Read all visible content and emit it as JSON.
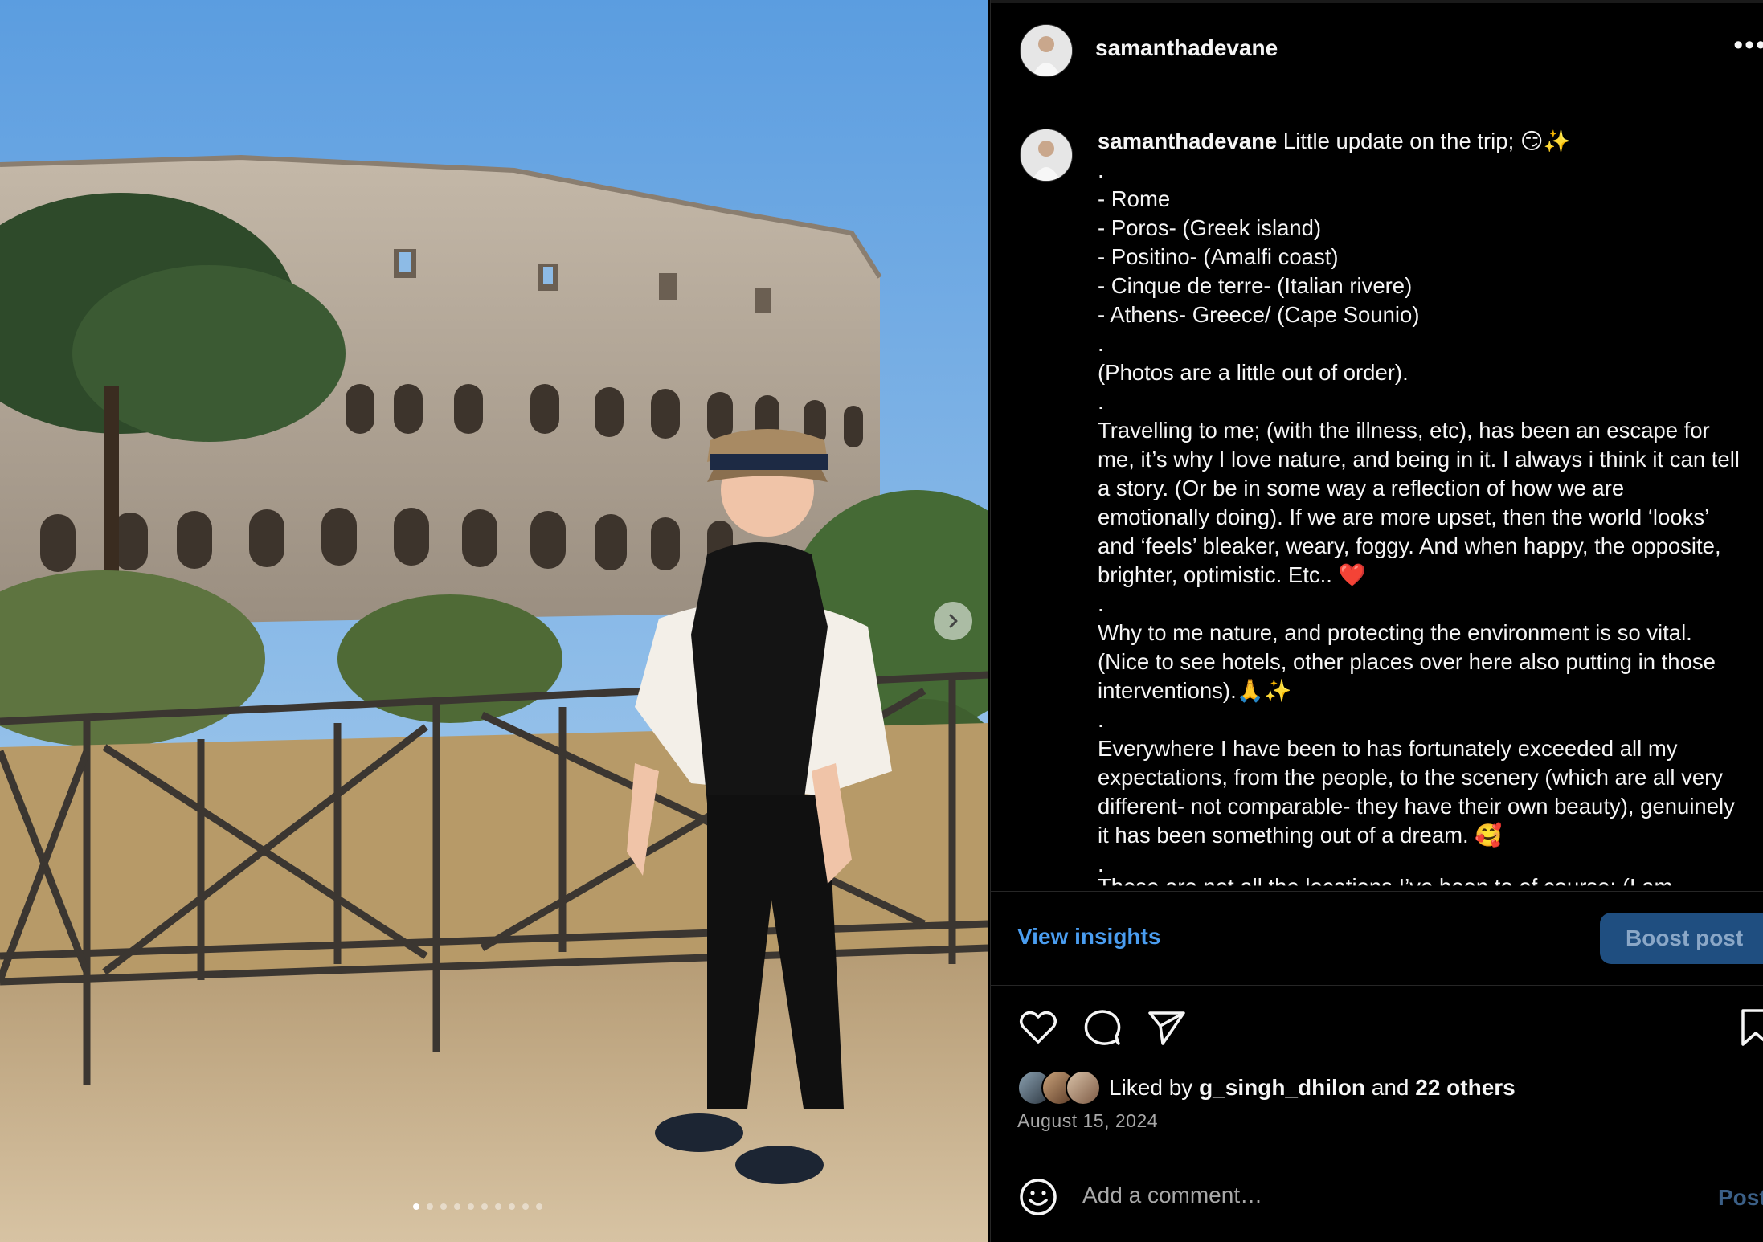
{
  "post": {
    "username": "samanthadevane",
    "more_label": "•••"
  },
  "caption": {
    "username": "samanthadevane",
    "intro": " Little update on the trip; 😏✨",
    "lines": [
      ".",
      "- Rome",
      "- Poros- (Greek island)",
      "- Positino- (Amalfi coast)",
      "- Cinque de terre- (Italian rivere)",
      "- Athens- Greece/ (Cape Sounio)",
      ".",
      "(Photos are a little out of order).",
      ".",
      "Travelling to me; (with the illness, etc), has been an escape for me, it’s why I love nature, and being in it. I always i think it can tell a story. (Or be in some way a reflection of how we are emotionally doing). If we are more upset, then the world ‘looks’ and ‘feels’ bleaker, weary, foggy. And when happy, the opposite, brighter, optimistic. Etc.. ❤️",
      ".",
      "Why to me nature, and protecting the environment is so vital. (Nice to see hotels, other places over here also putting in those interventions).🙏✨",
      ".",
      "Everywhere I have been to has fortunately exceeded all my expectations, from the people, to the scenery (which are all very different- not comparable- they have their own beauty), genuinely it has been something out of a dream. 🥰",
      "."
    ],
    "cut_line": "These are not all the locations I’ve been to of course; (I am"
  },
  "insights": {
    "view_label": "View insights",
    "boost_label": "Boost post"
  },
  "likes": {
    "prefix": "Liked by ",
    "user": "g_singh_dhilon",
    "middle": " and ",
    "others": "22 others"
  },
  "date": "August 15, 2024",
  "comment": {
    "placeholder": "Add a comment…",
    "post_label": "Post"
  },
  "carousel": {
    "slides": 10,
    "current": 1
  },
  "colors": {
    "background": "#000000",
    "link_blue": "#4a9df0",
    "boost_bg": "#1f4e80",
    "muted": "#a8a8a8"
  }
}
